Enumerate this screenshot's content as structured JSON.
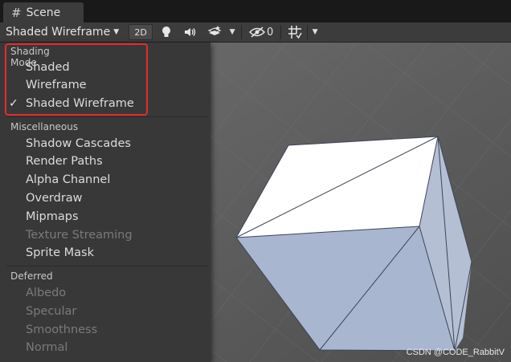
{
  "tab": {
    "title": "Scene",
    "icon": "grid-hash-icon"
  },
  "toolbar": {
    "shading_mode": "Shaded Wireframe",
    "btn_2d": "2D",
    "hidden_count": "0",
    "icons": [
      "lightbulb-icon",
      "audio-icon",
      "effects-icon",
      "visibility-icon",
      "gizmos-icon"
    ]
  },
  "menu": {
    "shading_mode": {
      "title": "Shading Mode",
      "items": [
        {
          "label": "Shaded"
        },
        {
          "label": "Wireframe"
        },
        {
          "label": "Shaded Wireframe",
          "checked": true
        }
      ]
    },
    "check_mark": "✓",
    "miscellaneous": {
      "title": "Miscellaneous",
      "items": [
        {
          "label": "Shadow Cascades"
        },
        {
          "label": "Render Paths"
        },
        {
          "label": "Alpha Channel"
        },
        {
          "label": "Overdraw"
        },
        {
          "label": "Mipmaps"
        },
        {
          "label": "Texture Streaming",
          "disabled": true
        },
        {
          "label": "Sprite Mask"
        }
      ]
    },
    "deferred": {
      "title": "Deferred",
      "items": [
        {
          "label": "Albedo",
          "disabled": true
        },
        {
          "label": "Specular",
          "disabled": true
        },
        {
          "label": "Smoothness",
          "disabled": true
        },
        {
          "label": "Normal",
          "disabled": true
        }
      ]
    }
  },
  "watermark": "CSDN @CODE_RabbitV",
  "colors": {
    "highlight_box": "#e52b2b",
    "cube_top": "#ffffff",
    "cube_side": "#a9b6cf"
  }
}
